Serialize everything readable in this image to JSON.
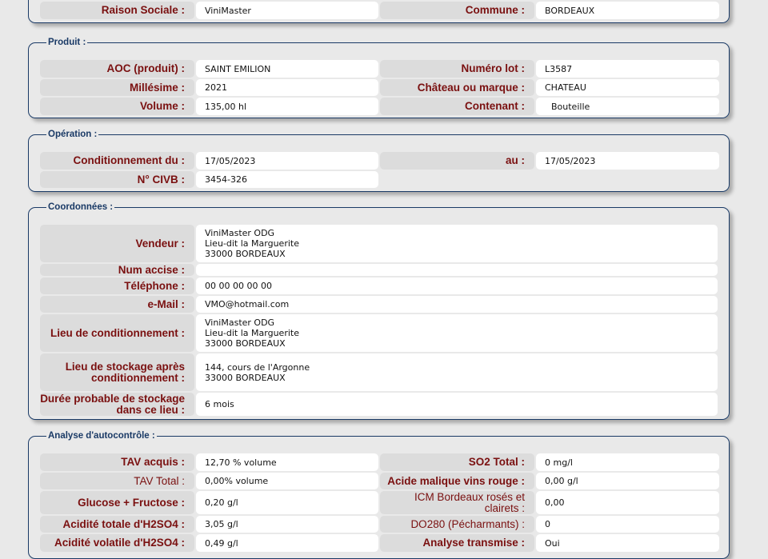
{
  "identification": {
    "raison_sociale_label": "Raison Sociale :",
    "raison_sociale_value": "ViniMaster",
    "commune_label": "Commune :",
    "commune_value": "BORDEAUX"
  },
  "produit": {
    "legend": "Produit :",
    "aoc_label": "AOC (produit) :",
    "aoc_value": "SAINT EMILION",
    "lot_label": "Numéro lot :",
    "lot_value": "L3587",
    "millesime_label": "Millésime :",
    "millesime_value": "2021",
    "chateau_label": "Château ou marque :",
    "chateau_value": "CHATEAU",
    "volume_label": "Volume :",
    "volume_value": "135,00 hl",
    "contenant_label": "Contenant :",
    "contenant_value": "Bouteille"
  },
  "operation": {
    "legend": "Opération :",
    "cond_du_label": "Conditionnement du :",
    "cond_du_value": "17/05/2023",
    "au_label": "au :",
    "au_value": "17/05/2023",
    "civb_label": "N° CIVB :",
    "civb_value": "3454-326"
  },
  "coordonnees": {
    "legend": "Coordonnées :",
    "vendeur_label": "Vendeur :",
    "vendeur_value": "ViniMaster ODG\nLieu-dit la Marguerite\n33000 BORDEAUX",
    "accise_label": "Num accise :",
    "accise_value": "",
    "telephone_label": "Téléphone :",
    "telephone_value": "00 00 00 00 00",
    "email_label": "e-Mail :",
    "email_value": "VMO@hotmail.com",
    "lieu_cond_label": "Lieu de conditionnement :",
    "lieu_cond_value": "ViniMaster ODG\nLieu-dit la Marguerite\n33000 BORDEAUX",
    "lieu_stock_label": "Lieu de stockage après conditionnement :",
    "lieu_stock_value": "144, cours de l'Argonne\n33000 BORDEAUX",
    "duree_label": "Durée probable de stockage dans ce lieu :",
    "duree_value": "6 mois"
  },
  "analyse": {
    "legend": "Analyse d'autocontrôle :",
    "tav_acquis_label": "TAV acquis :",
    "tav_acquis_value": "12,70 % volume",
    "so2_label": "SO2 Total :",
    "so2_value": "0 mg/l",
    "tav_total_label": "TAV Total :",
    "tav_total_value": "0,00% volume",
    "acide_malique_label": "Acide malique vins rouge :",
    "acide_malique_value": "0,00 g/l",
    "glucose_label": "Glucose + Fructose :",
    "glucose_value": "0,20 g/l",
    "icm_label": "ICM Bordeaux rosés et clairets :",
    "icm_value": "0,00",
    "acidite_totale_label": "Acidité totale d'H2SO4 :",
    "acidite_totale_value": "3,05 g/l",
    "do280_label": "DO280 (Pécharmants) :",
    "do280_value": "0",
    "acidite_volatile_label": "Acidité volatile d'H2SO4 :",
    "acidite_volatile_value": "0,49 g/l",
    "analyse_transmise_label": "Analyse transmise :",
    "analyse_transmise_value": "Oui"
  }
}
